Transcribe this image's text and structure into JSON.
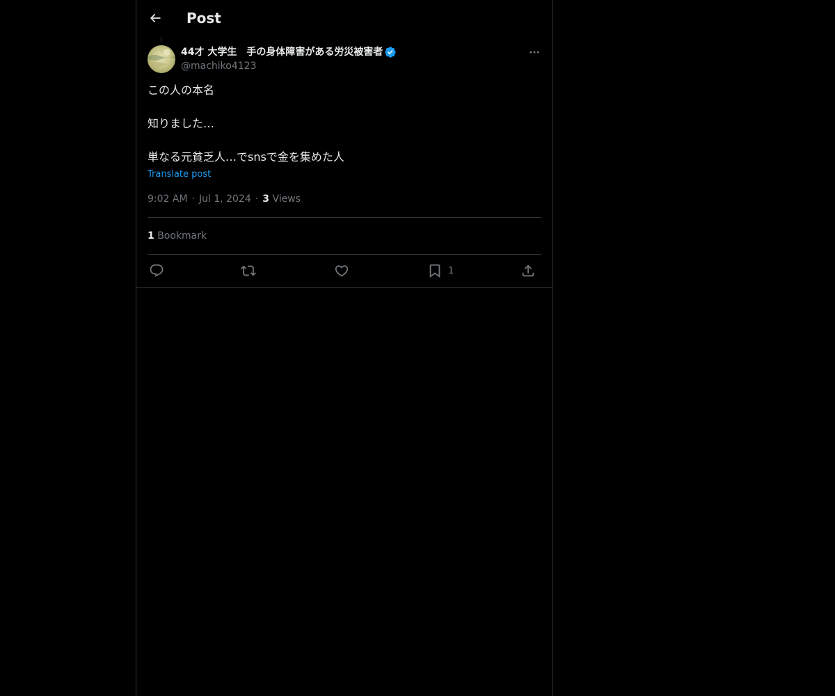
{
  "header": {
    "title": "Post"
  },
  "author": {
    "display_name": "44才 大学生　手の身体障害がある労災被害者",
    "handle": "@machiko4123",
    "verified": true
  },
  "post": {
    "lines": [
      "この人の本名",
      "",
      "知りました…",
      "",
      "単なる元貧乏人…でsnsで金を集めた人"
    ],
    "translate_label": "Translate post",
    "time": "9:02 AM",
    "date": "Jul 1, 2024",
    "views_count": "3",
    "views_label": "Views",
    "meta_separator": "·"
  },
  "engagement": {
    "bookmark_count": "1",
    "bookmark_label": "Bookmark"
  },
  "actions": {
    "reply_icon": "reply-icon",
    "repost_icon": "repost-icon",
    "like_icon": "like-icon",
    "bookmark_icon": "bookmark-icon",
    "bookmark_count": "1",
    "share_icon": "share-icon"
  },
  "colors": {
    "background": "#000000",
    "text": "#e7e9ea",
    "secondary": "#71767b",
    "accent": "#1d9bf0",
    "border": "#2f3336"
  }
}
